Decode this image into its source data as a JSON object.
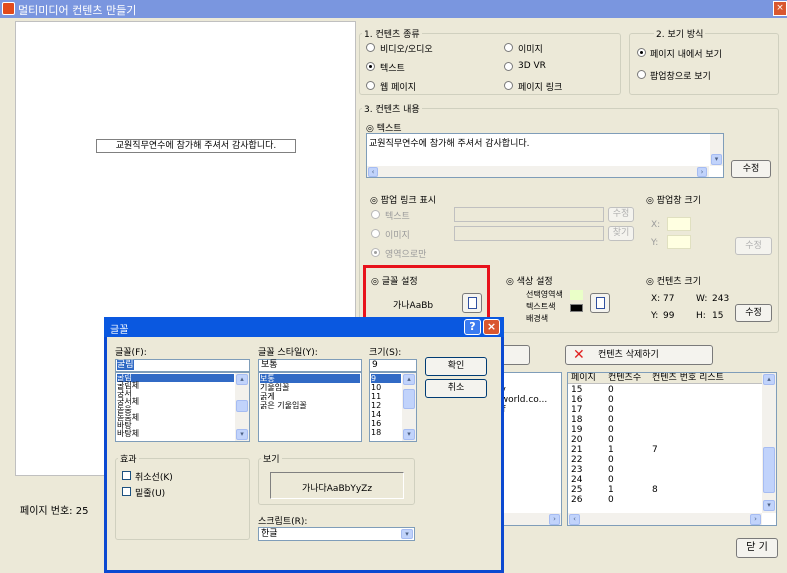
{
  "window": {
    "title": "멀티미디어 컨텐츠 만들기",
    "close": "×"
  },
  "preview": {
    "text": "교원직무연수에 참가해 주셔서 감사합니다.",
    "page_label": "페이지 번호: 25"
  },
  "content_type": {
    "legend": "1. 컨텐츠 종류",
    "options": [
      "비디오/오디오",
      "이미지",
      "텍스트",
      "3D VR",
      "웹 페이지",
      "페이지 링크"
    ],
    "selected": "텍스트"
  },
  "view_mode": {
    "legend": "2. 보기 방식",
    "options": [
      "페이지 내에서 보기",
      "팝업창으로 보기"
    ],
    "selected": "페이지 내에서 보기"
  },
  "content": {
    "legend": "3. 컨텐츠 내용",
    "text_label": "◎ 텍스트",
    "text_value": "교원직무연수에 참가해 주셔서 감사합니다.",
    "edit": "수정"
  },
  "popup": {
    "label": "◎ 팝업 링크 표시",
    "opts": [
      "텍스트",
      "이미지",
      "영역으로만"
    ],
    "edit": "수정",
    "find": "찾기",
    "size_label": "◎ 팝업창 크기",
    "x_label": "X:",
    "y_label": "Y:",
    "size_edit": "수정"
  },
  "font_setting": {
    "label": "◎ 글꼴 설정",
    "sample": "가나AaBb"
  },
  "color_setting": {
    "label": "◎ 색상 설정",
    "items": [
      "선택영역색",
      "텍스트색",
      "배경색"
    ],
    "colors": {
      "select": "#eaffc8",
      "text": "#000000"
    }
  },
  "content_size": {
    "label": "◎ 컨텐츠 크기",
    "x_label": "X:",
    "x": "77",
    "w_label": "W:",
    "w": "243",
    "y_label": "Y:",
    "y": "99",
    "h_label": "H:",
    "h": "15",
    "edit": "수정"
  },
  "delete_label": "컨텐츠 삭제하기",
  "list_partial": [
    "ov",
    "bworld.co...",
    "wf"
  ],
  "list": {
    "headers": [
      "페이지",
      "컨텐츠수",
      "컨텐츠 번호 리스트"
    ],
    "rows": [
      [
        "15",
        "0",
        ""
      ],
      [
        "16",
        "0",
        ""
      ],
      [
        "17",
        "0",
        ""
      ],
      [
        "18",
        "0",
        ""
      ],
      [
        "19",
        "0",
        ""
      ],
      [
        "20",
        "0",
        ""
      ],
      [
        "21",
        "1",
        "7"
      ],
      [
        "22",
        "0",
        ""
      ],
      [
        "23",
        "0",
        ""
      ],
      [
        "24",
        "0",
        ""
      ],
      [
        "25",
        "1",
        "8"
      ],
      [
        "26",
        "0",
        ""
      ]
    ]
  },
  "close_btn": "닫 기",
  "font_dialog": {
    "title": "글꼴",
    "help": "?",
    "close": "×",
    "font_label": "글꼴(F):",
    "font_value": "굴림",
    "fonts": [
      "굴림",
      "굴림체",
      "궁서",
      "궁서체",
      "돋움",
      "돋움체",
      "바탕",
      "바탕체"
    ],
    "style_label": "글꼴 스타일(Y):",
    "style_value": "보통",
    "styles": [
      "보통",
      "기울임꼴",
      "굵게",
      "굵은 기울임꼴"
    ],
    "size_label": "크기(S):",
    "size_value": "9",
    "sizes": [
      "9",
      "10",
      "11",
      "12",
      "14",
      "16",
      "18"
    ],
    "ok": "확인",
    "cancel": "취소",
    "effects_legend": "효과",
    "strike": "취소선(K)",
    "underline": "밑줄(U)",
    "sample_legend": "보기",
    "sample_text": "가나다AaBbYyZz",
    "script_label": "스크립트(R):",
    "script_value": "한글"
  }
}
